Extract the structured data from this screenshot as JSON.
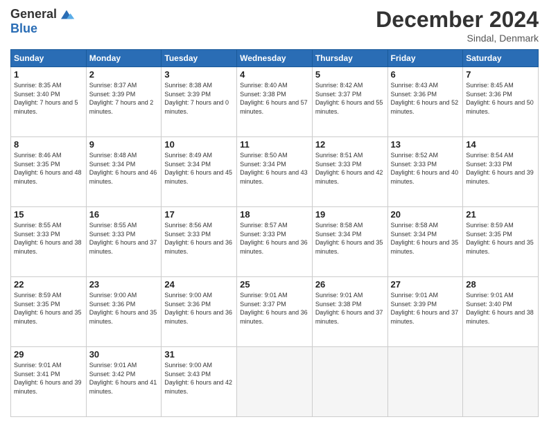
{
  "header": {
    "logo_general": "General",
    "logo_blue": "Blue",
    "month_title": "December 2024",
    "location": "Sindal, Denmark"
  },
  "days_of_week": [
    "Sunday",
    "Monday",
    "Tuesday",
    "Wednesday",
    "Thursday",
    "Friday",
    "Saturday"
  ],
  "cells": [
    {
      "day": "1",
      "sunrise": "8:35 AM",
      "sunset": "3:40 PM",
      "daylight": "7 hours and 5 minutes."
    },
    {
      "day": "2",
      "sunrise": "8:37 AM",
      "sunset": "3:39 PM",
      "daylight": "7 hours and 2 minutes."
    },
    {
      "day": "3",
      "sunrise": "8:38 AM",
      "sunset": "3:39 PM",
      "daylight": "7 hours and 0 minutes."
    },
    {
      "day": "4",
      "sunrise": "8:40 AM",
      "sunset": "3:38 PM",
      "daylight": "6 hours and 57 minutes."
    },
    {
      "day": "5",
      "sunrise": "8:42 AM",
      "sunset": "3:37 PM",
      "daylight": "6 hours and 55 minutes."
    },
    {
      "day": "6",
      "sunrise": "8:43 AM",
      "sunset": "3:36 PM",
      "daylight": "6 hours and 52 minutes."
    },
    {
      "day": "7",
      "sunrise": "8:45 AM",
      "sunset": "3:36 PM",
      "daylight": "6 hours and 50 minutes."
    },
    {
      "day": "8",
      "sunrise": "8:46 AM",
      "sunset": "3:35 PM",
      "daylight": "6 hours and 48 minutes."
    },
    {
      "day": "9",
      "sunrise": "8:48 AM",
      "sunset": "3:34 PM",
      "daylight": "6 hours and 46 minutes."
    },
    {
      "day": "10",
      "sunrise": "8:49 AM",
      "sunset": "3:34 PM",
      "daylight": "6 hours and 45 minutes."
    },
    {
      "day": "11",
      "sunrise": "8:50 AM",
      "sunset": "3:34 PM",
      "daylight": "6 hours and 43 minutes."
    },
    {
      "day": "12",
      "sunrise": "8:51 AM",
      "sunset": "3:33 PM",
      "daylight": "6 hours and 42 minutes."
    },
    {
      "day": "13",
      "sunrise": "8:52 AM",
      "sunset": "3:33 PM",
      "daylight": "6 hours and 40 minutes."
    },
    {
      "day": "14",
      "sunrise": "8:54 AM",
      "sunset": "3:33 PM",
      "daylight": "6 hours and 39 minutes."
    },
    {
      "day": "15",
      "sunrise": "8:55 AM",
      "sunset": "3:33 PM",
      "daylight": "6 hours and 38 minutes."
    },
    {
      "day": "16",
      "sunrise": "8:55 AM",
      "sunset": "3:33 PM",
      "daylight": "6 hours and 37 minutes."
    },
    {
      "day": "17",
      "sunrise": "8:56 AM",
      "sunset": "3:33 PM",
      "daylight": "6 hours and 36 minutes."
    },
    {
      "day": "18",
      "sunrise": "8:57 AM",
      "sunset": "3:33 PM",
      "daylight": "6 hours and 36 minutes."
    },
    {
      "day": "19",
      "sunrise": "8:58 AM",
      "sunset": "3:34 PM",
      "daylight": "6 hours and 35 minutes."
    },
    {
      "day": "20",
      "sunrise": "8:58 AM",
      "sunset": "3:34 PM",
      "daylight": "6 hours and 35 minutes."
    },
    {
      "day": "21",
      "sunrise": "8:59 AM",
      "sunset": "3:35 PM",
      "daylight": "6 hours and 35 minutes."
    },
    {
      "day": "22",
      "sunrise": "8:59 AM",
      "sunset": "3:35 PM",
      "daylight": "6 hours and 35 minutes."
    },
    {
      "day": "23",
      "sunrise": "9:00 AM",
      "sunset": "3:36 PM",
      "daylight": "6 hours and 35 minutes."
    },
    {
      "day": "24",
      "sunrise": "9:00 AM",
      "sunset": "3:36 PM",
      "daylight": "6 hours and 36 minutes."
    },
    {
      "day": "25",
      "sunrise": "9:01 AM",
      "sunset": "3:37 PM",
      "daylight": "6 hours and 36 minutes."
    },
    {
      "day": "26",
      "sunrise": "9:01 AM",
      "sunset": "3:38 PM",
      "daylight": "6 hours and 37 minutes."
    },
    {
      "day": "27",
      "sunrise": "9:01 AM",
      "sunset": "3:39 PM",
      "daylight": "6 hours and 37 minutes."
    },
    {
      "day": "28",
      "sunrise": "9:01 AM",
      "sunset": "3:40 PM",
      "daylight": "6 hours and 38 minutes."
    },
    {
      "day": "29",
      "sunrise": "9:01 AM",
      "sunset": "3:41 PM",
      "daylight": "6 hours and 39 minutes."
    },
    {
      "day": "30",
      "sunrise": "9:01 AM",
      "sunset": "3:42 PM",
      "daylight": "6 hours and 41 minutes."
    },
    {
      "day": "31",
      "sunrise": "9:00 AM",
      "sunset": "3:43 PM",
      "daylight": "6 hours and 42 minutes."
    }
  ]
}
